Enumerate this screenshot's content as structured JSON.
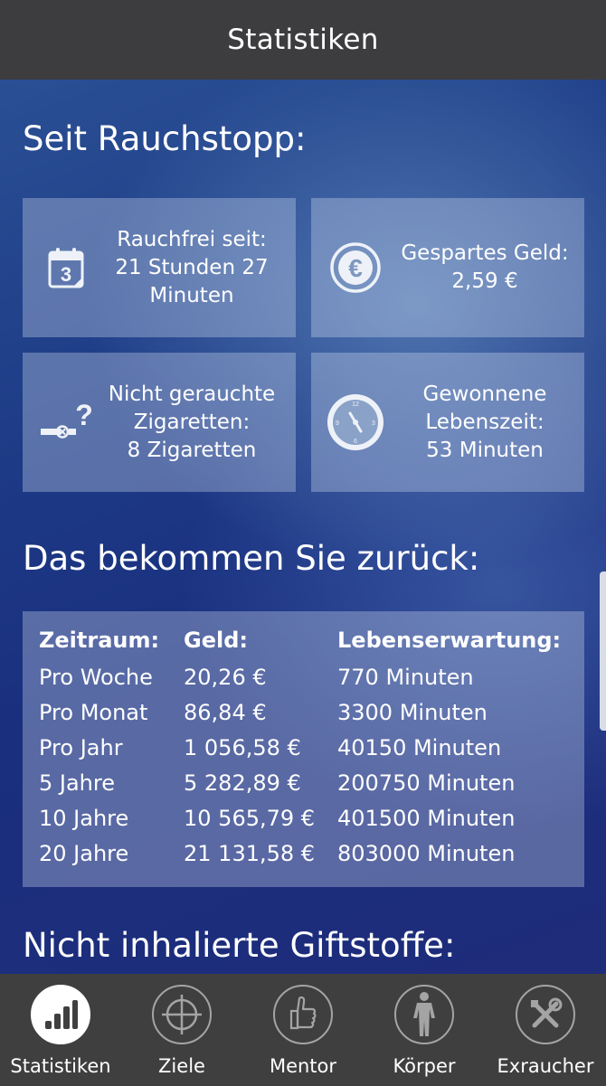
{
  "header": {
    "title": "Statistiken"
  },
  "section1": {
    "title": "Seit Rauchstopp:"
  },
  "cards": [
    {
      "lines": [
        "Rauchfrei seit:",
        "21 Stunden 27",
        "Minuten"
      ],
      "icon": "calendar-icon",
      "calendar_day": "3"
    },
    {
      "lines": [
        "Gespartes Geld:",
        "2,59 €"
      ],
      "icon": "euro-icon",
      "symbol": "€"
    },
    {
      "lines": [
        "Nicht gerauchte",
        "Zigaretten:",
        "8 Zigaretten"
      ],
      "icon": "cigarette-question-icon",
      "symbol": "?"
    },
    {
      "lines": [
        "Gewonnene",
        "Lebenszeit:",
        "53 Minuten"
      ],
      "icon": "clock-icon",
      "clock_marks": [
        "12",
        "3",
        "6",
        "9"
      ]
    }
  ],
  "section2": {
    "title": "Das bekommen Sie zurück:"
  },
  "table": {
    "headers": [
      "Zeitraum:",
      "Geld:",
      "Lebenserwartung:"
    ],
    "rows": [
      [
        "Pro Woche",
        "20,26 €",
        "770 Minuten"
      ],
      [
        "Pro Monat",
        "86,84 €",
        "3300 Minuten"
      ],
      [
        "Pro Jahr",
        "1 056,58 €",
        "40150 Minuten"
      ],
      [
        "5 Jahre",
        "5 282,89 €",
        "200750 Minuten"
      ],
      [
        "10 Jahre",
        "10 565,79 €",
        "401500 Minuten"
      ],
      [
        "20 Jahre",
        "21 131,58 €",
        "803000 Minuten"
      ]
    ]
  },
  "section3": {
    "title": "Nicht inhalierte Giftstoffe:"
  },
  "nav": [
    {
      "label": "Statistiken",
      "icon": "bar-chart-icon",
      "active": true
    },
    {
      "label": "Ziele",
      "icon": "crosshair-icon",
      "active": false
    },
    {
      "label": "Mentor",
      "icon": "thumbs-up-icon",
      "active": false
    },
    {
      "label": "Körper",
      "icon": "body-icon",
      "active": false
    },
    {
      "label": "Exraucher",
      "icon": "tools-icon",
      "active": false
    }
  ],
  "colors": {
    "header_bg": "#3d3d3f",
    "nav_bg": "#3f3f40",
    "accent_dark": "#1b2f7c"
  }
}
